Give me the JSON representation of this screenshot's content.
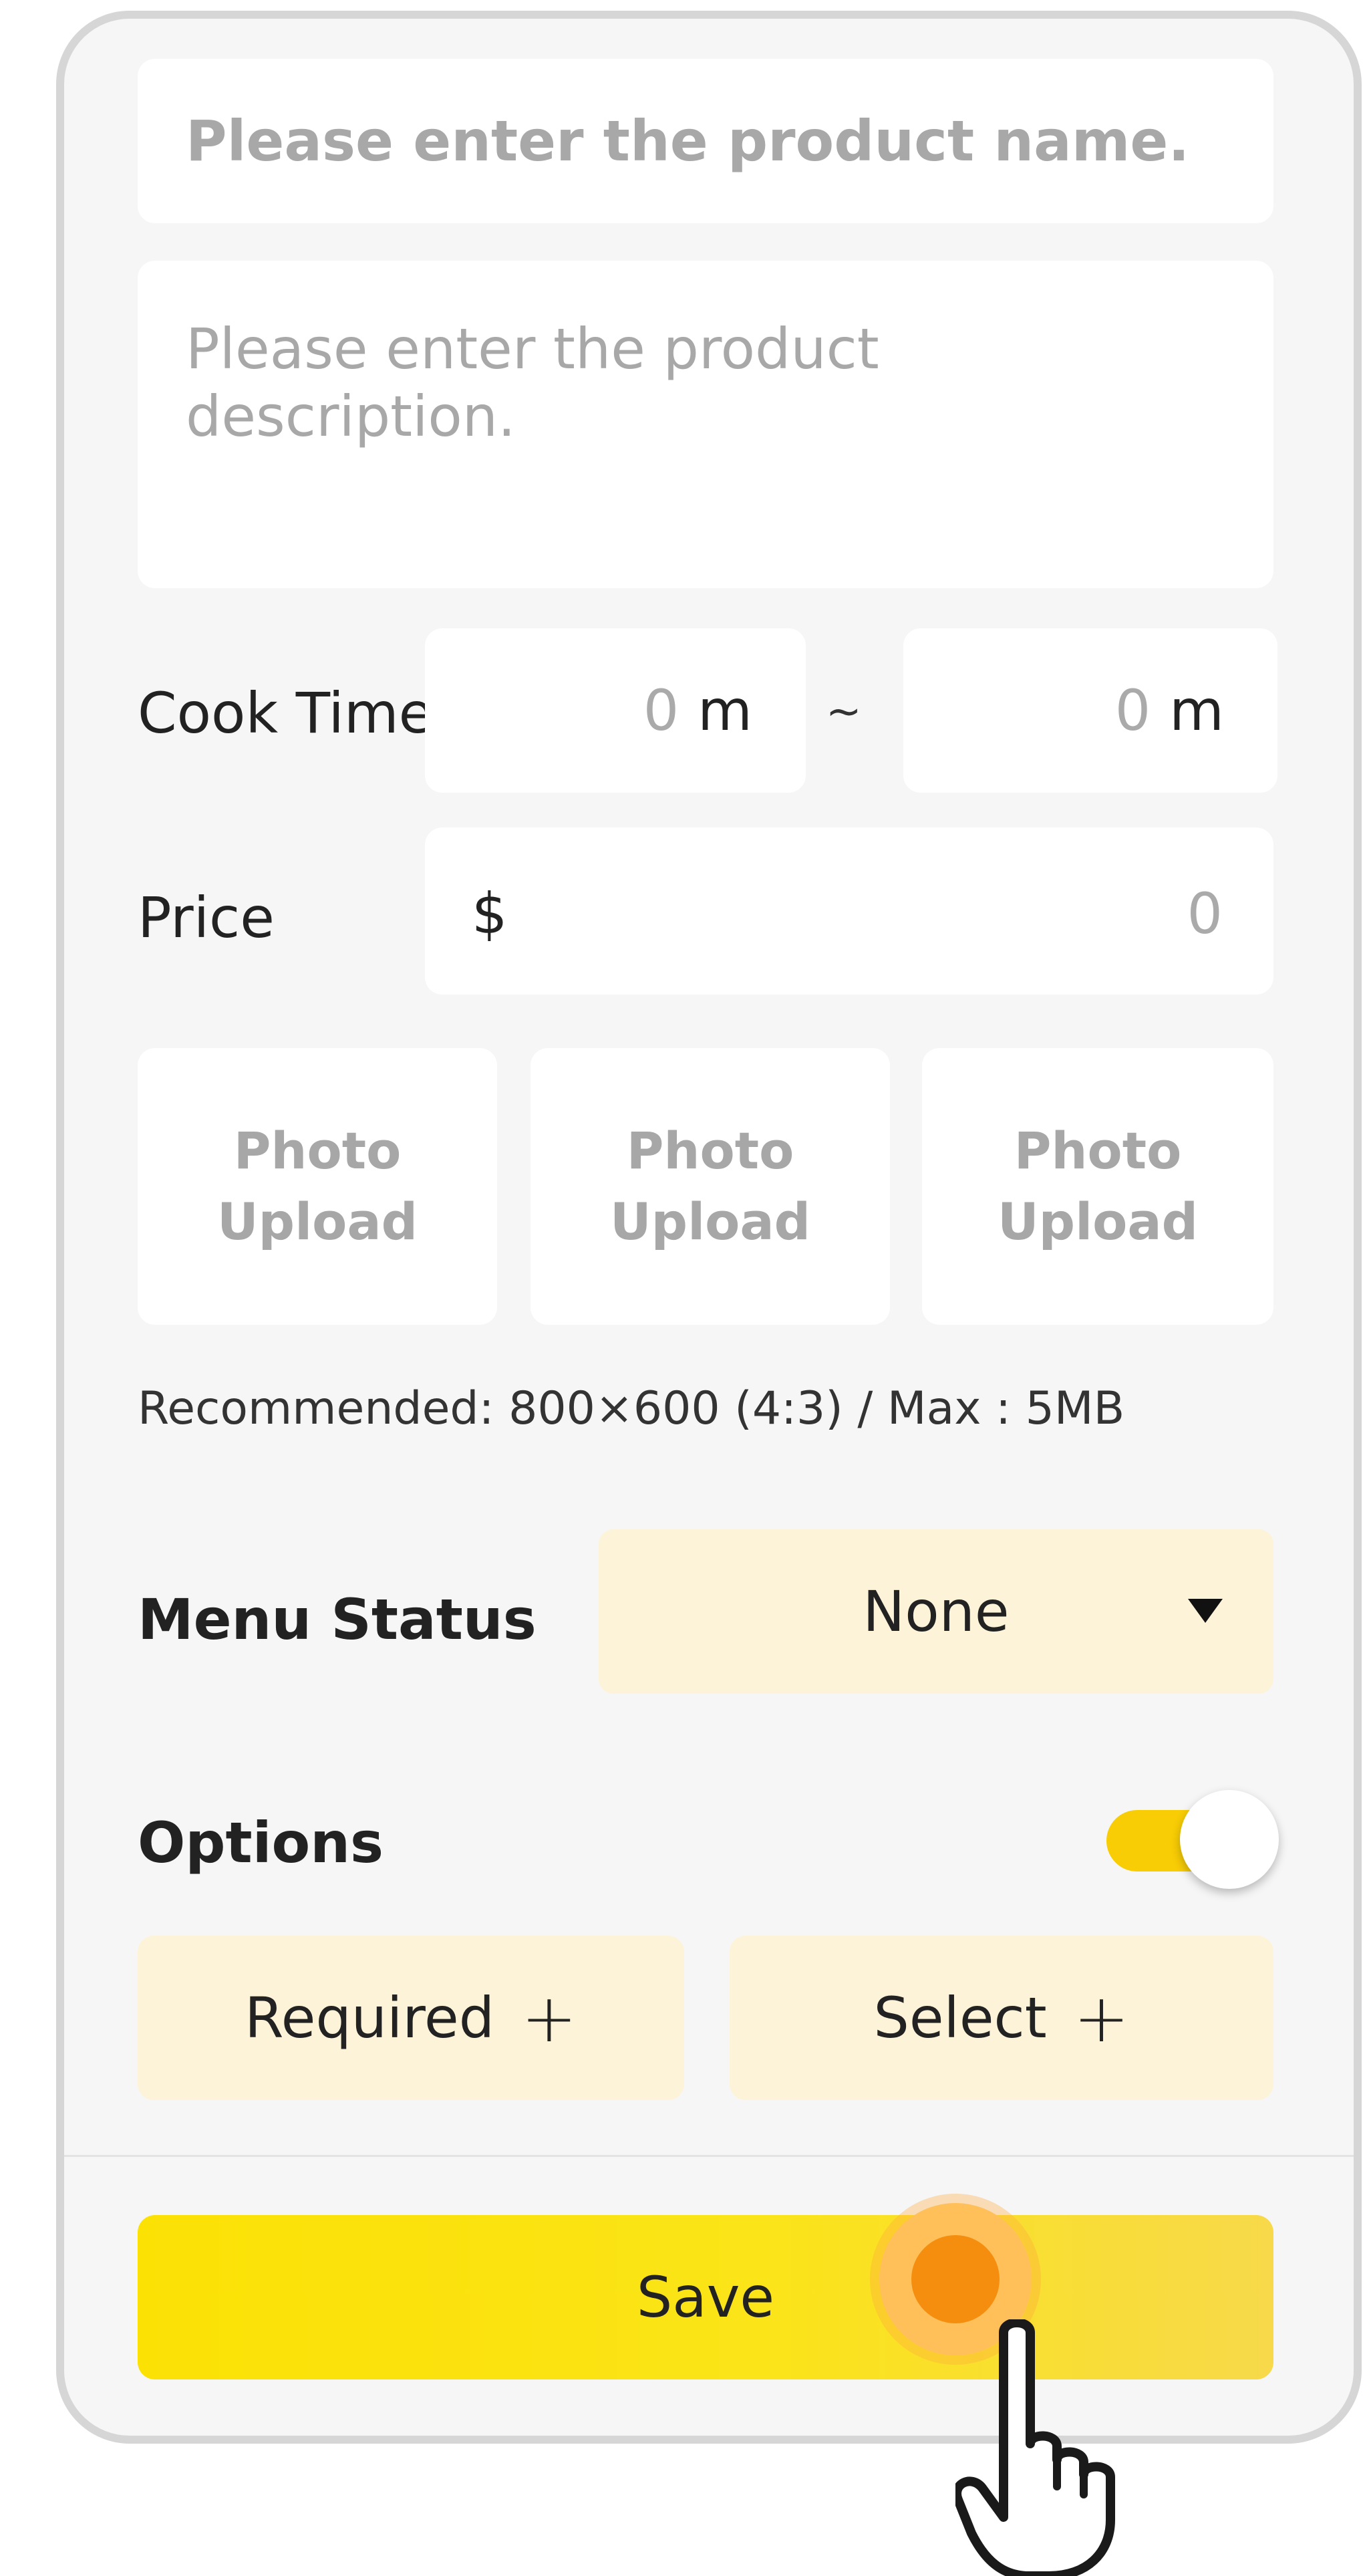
{
  "form": {
    "name_placeholder": "Please enter the product name.",
    "description_placeholder": "Please enter the product description.",
    "cook_time": {
      "label": "Cook Time",
      "min_value": "0",
      "max_value": "0",
      "unit": "m",
      "separator": "~"
    },
    "price": {
      "label": "Price",
      "currency": "$",
      "value": "0"
    },
    "photo_upload": [
      {
        "line1": "Photo",
        "line2": "Upload"
      },
      {
        "line1": "Photo",
        "line2": "Upload"
      },
      {
        "line1": "Photo",
        "line2": "Upload"
      }
    ],
    "photo_hint": "Recommended: 800×600 (4:3) / Max : 5MB",
    "menu_status": {
      "label": "Menu Status",
      "value": "None"
    },
    "options": {
      "label": "Options",
      "toggle_on": true,
      "required_label": "Required",
      "select_label": "Select",
      "plus": "+"
    }
  },
  "save_label": "Save",
  "colors": {
    "accent_yellow": "#fbe104",
    "option_bg": "#fdf3d8",
    "toggle": "#f8cd05",
    "tap": "#f58e0e"
  },
  "icons": [
    "chevron-down-icon",
    "plus-icon",
    "pointer-hand-icon"
  ]
}
